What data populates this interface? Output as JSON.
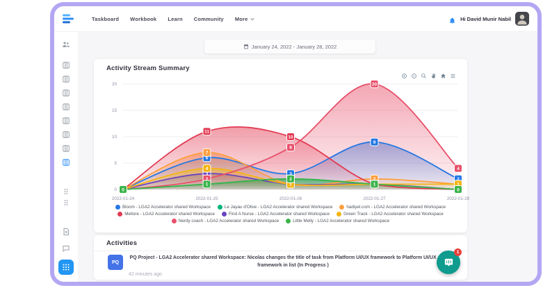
{
  "window": {
    "frame_color": "#b3a7f3"
  },
  "header": {
    "nav_items": [
      "Taskboard",
      "Workbook",
      "Learn",
      "Community",
      "More"
    ],
    "greeting": "Hi David Munir Nabil"
  },
  "date_filter": {
    "label": "January 24, 2022 - January 28, 2022",
    "icon": "calendar-icon"
  },
  "summary_card": {
    "title": "Activity Stream Summary",
    "toolbar": [
      "zoom-in",
      "zoom-out",
      "selection-zoom",
      "pan",
      "reset-zoom",
      "menu"
    ]
  },
  "chart_data": {
    "type": "area",
    "title": "Activity Stream Summary",
    "categories": [
      "2022-01-24",
      "2022-01-25",
      "2022-01-26",
      "2022-01-27",
      "2022-01-28"
    ],
    "ylim": [
      0,
      20
    ],
    "yticks": [
      0,
      5,
      10,
      15,
      20
    ],
    "grid": true,
    "legend_position": "bottom",
    "series": [
      {
        "name": "Bloom - LGA2 Accelerator shared Workspace",
        "color": "#2577e3",
        "values": [
          0,
          6,
          3,
          9,
          2
        ]
      },
      {
        "name": "Le Jayau d'Olive - LGA2 Accelerator shared Workspace",
        "color": "#00b577",
        "values": [
          0,
          1,
          2,
          1,
          0
        ]
      },
      {
        "name": "hadiyel.com - LGA2 Accelerator shared Workspace",
        "color": "#ff9f40",
        "values": [
          0,
          7,
          1,
          2,
          1
        ]
      },
      {
        "name": "Mellore - LGA2 Accelerator shared Workspace",
        "color": "#e23a52",
        "values": [
          0,
          11,
          10,
          1,
          0
        ]
      },
      {
        "name": "Find A Nurse - LGA2 Accelerator shared Workspace",
        "color": "#6a45c2",
        "values": [
          0,
          3,
          1,
          1,
          0
        ]
      },
      {
        "name": "Green Track - LGA2 Accelerator shared Workspace",
        "color": "#f3b415",
        "values": [
          0,
          4,
          1,
          1,
          1
        ]
      },
      {
        "name": "Nerdy coach - LGA2 Accelerator shared Workspace",
        "color": "#e8506a",
        "values": [
          0,
          2,
          8,
          20,
          4
        ]
      },
      {
        "name": "Little Melly - LGA2 Accelerator shared Workspace",
        "color": "#3cb44b",
        "values": [
          0,
          1,
          2,
          1,
          0
        ]
      }
    ]
  },
  "activities": {
    "title": "Activities",
    "items": [
      {
        "logo_text": "PQ",
        "text": "PQ Project - LGA2 Accelerator shared Workspace: Nicolas changes the title of task from Platform UI/UX framework to Platform UI/UX concept framework in list (In Progress )",
        "time": "42 minutes ago"
      }
    ]
  },
  "sidebar": {
    "items": [
      {
        "icon": "people"
      },
      {
        "icon": "board"
      },
      {
        "icon": "board"
      },
      {
        "icon": "board"
      },
      {
        "icon": "board"
      },
      {
        "icon": "board"
      },
      {
        "icon": "board"
      },
      {
        "icon": "board"
      },
      {
        "icon": "board",
        "active": true
      },
      {
        "icon": "dots"
      },
      {
        "icon": "dots"
      },
      {
        "icon": "doc"
      },
      {
        "icon": "chat"
      }
    ],
    "bottom_button_icon": "apps"
  },
  "chat_launcher": {
    "badge": "1",
    "color": "#0f9b8e"
  },
  "colors": {
    "accent": "#2c8ef8",
    "frame": "#b3a7f3",
    "chat_bubble": "#0f9b8e",
    "badge": "#e8403a"
  }
}
